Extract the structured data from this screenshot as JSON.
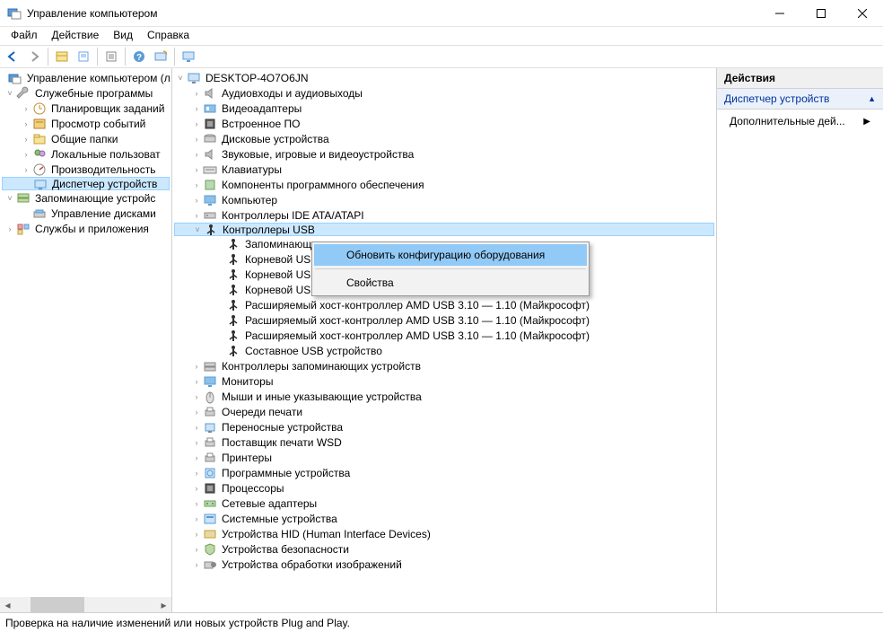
{
  "window": {
    "title": "Управление компьютером"
  },
  "menu": {
    "file": "Файл",
    "action": "Действие",
    "view": "Вид",
    "help": "Справка"
  },
  "left_tree": {
    "root": "Управление компьютером (л",
    "n1": "Служебные программы",
    "n1a": "Планировщик заданий",
    "n1b": "Просмотр событий",
    "n1c": "Общие папки",
    "n1d": "Локальные пользоват",
    "n1e": "Производительность",
    "n1f": "Диспетчер устройств",
    "n2": "Запоминающие устройс",
    "n2a": "Управление дисками",
    "n3": "Службы и приложения"
  },
  "center_tree": {
    "root": "DESKTOP-4O7O6JN",
    "items": [
      "Аудиовходы и аудиовыходы",
      "Видеоадаптеры",
      "Встроенное ПО",
      "Дисковые устройства",
      "Звуковые, игровые и видеоустройства",
      "Клавиатуры",
      "Компоненты программного обеспечения",
      "Компьютер",
      "Контроллеры IDE ATA/ATAPI"
    ],
    "usb": "Контроллеры USB",
    "usb_children": [
      "Запоминающ",
      "Корневой USB",
      "Корневой USB",
      "Корневой USB-концентратор (USB 3.0)",
      "Расширяемый хост-контроллер AMD USB 3.10 — 1.10 (Майкрософт)",
      "Расширяемый хост-контроллер AMD USB 3.10 — 1.10 (Майкрософт)",
      "Расширяемый хост-контроллер AMD USB 3.10 — 1.10 (Майкрософт)",
      "Составное USB устройство"
    ],
    "tail": [
      "Контроллеры запоминающих устройств",
      "Мониторы",
      "Мыши и иные указывающие устройства",
      "Очереди печати",
      "Переносные устройства",
      "Поставщик печати WSD",
      "Принтеры",
      "Программные устройства",
      "Процессоры",
      "Сетевые адаптеры",
      "Системные устройства",
      "Устройства HID (Human Interface Devices)",
      "Устройства безопасности",
      "Устройства обработки изображений"
    ]
  },
  "context_menu": {
    "scan": "Обновить конфигурацию оборудования",
    "props": "Свойства"
  },
  "actions": {
    "title": "Действия",
    "sub": "Диспетчер устройств",
    "link": "Дополнительные дей..."
  },
  "status": "Проверка на наличие изменений или новых устройств Plug and Play."
}
